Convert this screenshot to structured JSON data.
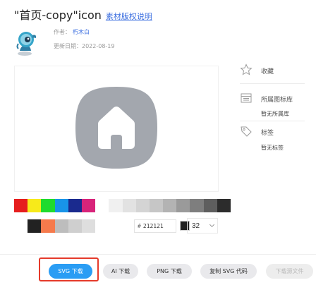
{
  "header": {
    "icon_title": "\"首页-copy\"icon",
    "license_link": "素材版权说明"
  },
  "meta": {
    "author_label": "作者：",
    "author_name": "朽木白",
    "updated_label": "更新日期：2022-08-19"
  },
  "sidebar": {
    "favorite_label": "收藏",
    "library_label": "所属图标库",
    "library_value": "暂无所属库",
    "tags_label": "标签",
    "tags_value": "暂无标签"
  },
  "palette": {
    "row1": [
      "#e61e1e",
      "#f7ea1a",
      "#1fdb2e",
      "#1894e8",
      "#1a2a8e",
      "#d8247a",
      "#ffffff",
      "#f0f0f0",
      "#e2e2e2",
      "#d4d4d4",
      "#c6c6c6",
      "#b3b3b3",
      "#9a9a9a",
      "#7e7e7e",
      "#5e5e5e",
      "#2c2c2c"
    ],
    "row2": [
      "#ffffff",
      "#222222",
      "#f57a4c",
      "#bdbdbd",
      "#cfcfcf",
      "#dedede"
    ]
  },
  "color_picker": {
    "hash": "#",
    "hex_value": "212121",
    "current_color": "#212121"
  },
  "size_select": {
    "value": "32"
  },
  "preview": {
    "icon_bg_color": "#a3a7ae",
    "icon_fg_color": "#ffffff"
  },
  "buttons": {
    "svg_download": "SVG 下载",
    "ai_download": "AI 下载",
    "png_download": "PNG 下载",
    "copy_svg_code": "复制 SVG 代码",
    "source_download": "下载源文件"
  }
}
